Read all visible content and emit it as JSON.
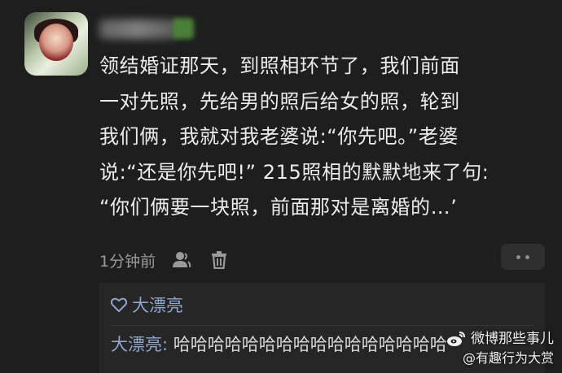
{
  "comment": {
    "text": "领结婚证那天，到照相环节了，我们前面\n一对先照，先给男的照后给女的照，轮到\n我们俩，我就对我老婆说:“你先吧。”老婆\n说:“还是你先吧!” 215照相的默默地来了句:\n“你们俩要一块照，前面那对是离婚的…’",
    "time": "1分钟前"
  },
  "reply": {
    "liker": "大漂亮",
    "author": "大漂亮:",
    "text": " 哈哈哈哈哈哈哈哈哈哈哈哈哈哈哈哈"
  },
  "watermark": {
    "line1": "微博那些事儿",
    "line2": "@有趣行为大赏"
  },
  "colors": {
    "background": "#1e1e1e",
    "text": "#ececec",
    "muted": "#9a9a9a",
    "link": "#8fa6cf",
    "reply_bg": "#262626"
  }
}
